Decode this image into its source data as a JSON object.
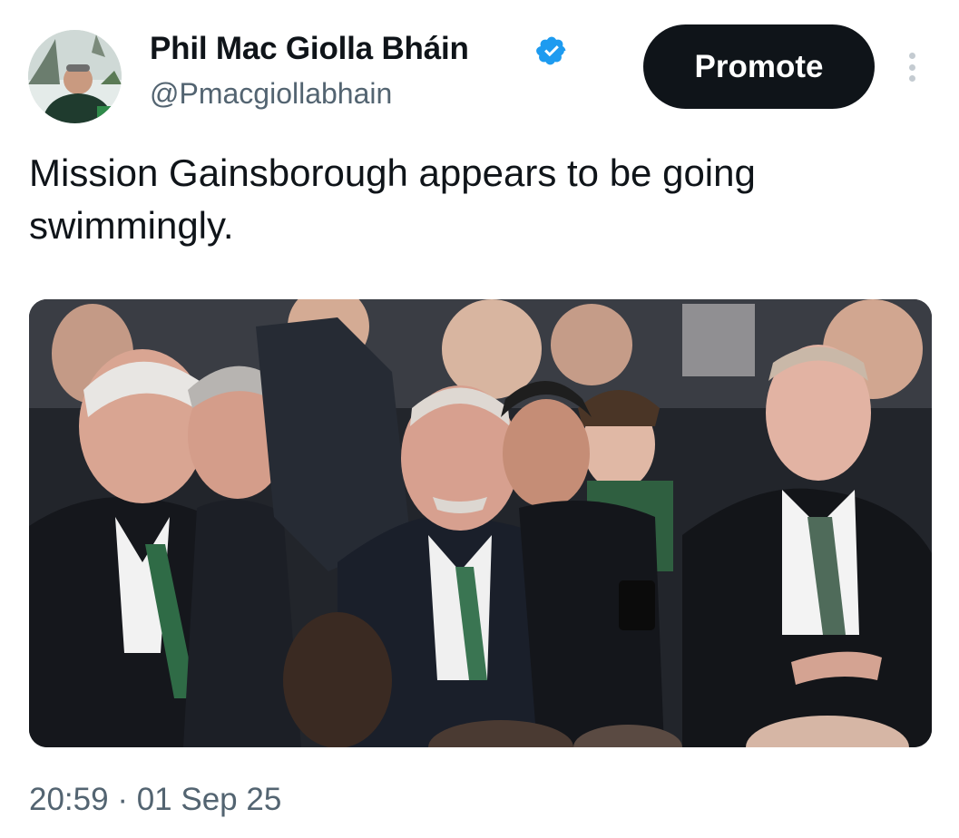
{
  "tweet": {
    "author": {
      "display_name": "Phil Mac Giolla Bháin",
      "handle": "@Pmacgiollabhain",
      "verified": true,
      "avatar_icon": "profile-photo"
    },
    "promote_label": "Promote",
    "more_icon": "vertical-ellipsis-icon",
    "text_line1": "Mission Gainsborough appears to be going",
    "text_line2": "swimmingly.",
    "photo_description_icon": "photo",
    "time": "20:59",
    "separator": "·",
    "date": "01 Sep 25"
  },
  "colors": {
    "text_primary": "#0f1419",
    "text_secondary": "#536471",
    "verified_blue": "#1d9bf0",
    "button_bg": "#0f1419",
    "button_text": "#ffffff"
  }
}
